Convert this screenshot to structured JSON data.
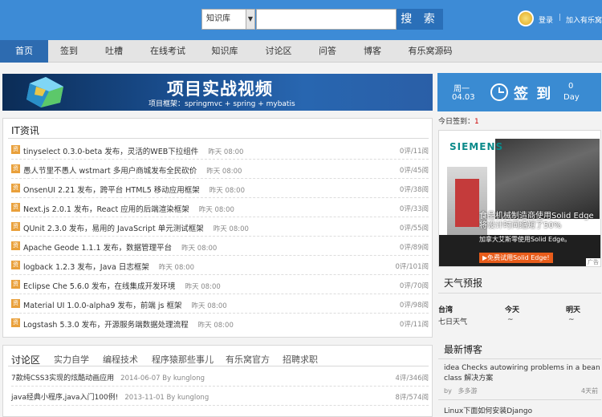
{
  "header": {
    "select_value": "知识库",
    "search_button": "搜 索",
    "login": "登录",
    "separator": "|",
    "join": "加入有乐窝"
  },
  "nav": [
    "首页",
    "签到",
    "吐槽",
    "在线考试",
    "知识库",
    "讨论区",
    "问答",
    "博客",
    "有乐窝源码"
  ],
  "banner": {
    "title": "项目实战视频",
    "subtitle": "项目框架：springmvc + spring + mybatis"
  },
  "signin": {
    "weekday": "周一",
    "date": "04.03",
    "label": "签 到",
    "days": "0",
    "days_unit": "Day"
  },
  "today_signins": {
    "label": "今日签到：",
    "count": "1"
  },
  "it_news": {
    "heading": "IT资讯",
    "items": [
      {
        "title": "tinyselect 0.3.0-beta 发布，灵活的WEB下拉组件",
        "date": "昨天 08:00",
        "stats": "0评/11阅"
      },
      {
        "title": "愚人节里不愚人 wstmart 多用户商城发布全民砍价",
        "date": "昨天 08:00",
        "stats": "0评/45阅"
      },
      {
        "title": "OnsenUI 2.21 发布，跨平台 HTML5 移动应用框架",
        "date": "昨天 08:00",
        "stats": "0评/38阅"
      },
      {
        "title": "Next.js 2.0.1 发布，React 应用的后端渲染框架",
        "date": "昨天 08:00",
        "stats": "0评/33阅"
      },
      {
        "title": "QUnit 2.3.0 发布，易用的 JavaScript 单元测试框架",
        "date": "昨天 08:00",
        "stats": "0评/55阅"
      },
      {
        "title": "Apache Geode 1.1.1 发布，数据管理平台",
        "date": "昨天 08:00",
        "stats": "0评/89阅"
      },
      {
        "title": "logback 1.2.3 发布，Java 日志框架",
        "date": "昨天 08:00",
        "stats": "0评/101阅"
      },
      {
        "title": "Eclipse Che 5.6.0 发布，在线集成开发环境",
        "date": "昨天 08:00",
        "stats": "0评/70阅"
      },
      {
        "title": "Material UI 1.0.0-alpha9 发布，前端 js 框架",
        "date": "昨天 08:00",
        "stats": "0评/98阅"
      },
      {
        "title": "Logstash 5.3.0 发布，开源服务端数据处理流程",
        "date": "昨天 08:00",
        "stats": "0评/11阅"
      }
    ]
  },
  "discussion": {
    "tabs": [
      "讨论区",
      "实力自学",
      "编程技术",
      "程序猿那些事儿",
      "有乐窝官方",
      "招聘求职"
    ],
    "items": [
      {
        "title": "7款纯CSS3实现的炫酷动画应用",
        "meta": "2014-06-07 By kunglong",
        "stats": "4评/346阅"
      },
      {
        "title": "java经典小程序,java入门100例!",
        "meta": "2013-11-01 By kunglong",
        "stats": "8评/574阅"
      }
    ]
  },
  "ad": {
    "brand": "SIEMENS",
    "line1": "食品机械制造商使用Solid Edge",
    "line2": "将设计时间缩短了50%",
    "line3": "加拿大艾斯零使用Solid Edge。",
    "cta": "▶免费试用Solid Edge!",
    "flag": "广告"
  },
  "weather": {
    "heading": "天气预报",
    "headers": [
      "台湾",
      "今天",
      "明天"
    ],
    "values": [
      "七日天气",
      "~",
      "~"
    ]
  },
  "blogs": {
    "heading": "最新博客",
    "item_title": "idea Checks autowiring problems in a bean class 解决方案",
    "by_label": "by",
    "author": "多多游",
    "time": "4天前",
    "next_title": "Linux下面如何安装Django"
  }
}
